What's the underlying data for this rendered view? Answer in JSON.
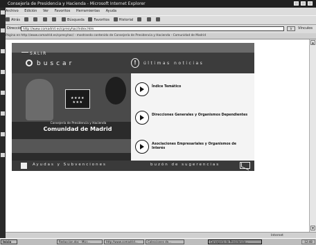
{
  "window": {
    "title": "Consejería de Presidencia y Hacienda - Microsoft Internet Explorer"
  },
  "menubar": [
    "Archivo",
    "Edición",
    "Ver",
    "Favoritos",
    "Herramientas",
    "Ayuda"
  ],
  "toolbar": {
    "back": "Atrás",
    "search": "Búsqueda",
    "favorites": "Favoritos",
    "history": "Historial"
  },
  "addressbar": {
    "label": "Dirección",
    "value": "http://www.comadrid.es/cpresyhac/index.htm",
    "go": "Ir",
    "links": "Vínculos"
  },
  "infobar": "Página en http://www.comadrid.es/cpresyhac/ - mostrando contenido de Consejería de Presidencia y Hacienda - Comunidad de Madrid",
  "site": {
    "salir": "SALIR",
    "buscar": "buscar",
    "news": "últimas noticias",
    "flag_stars": "★★★★\n★★★",
    "consejeria": "Consejería de Presidencia y Hacienda",
    "comunidad": "Comunidad de Madrid",
    "menu": [
      "Índice Temático",
      "Direcciones Generales y Organismos Dependientes",
      "Asociaciones Empresariales y Organismos de Interés"
    ],
    "ayudas": "Ayudas y Subvenciones",
    "buzon": "buzón de sugerencias"
  },
  "statusbar": {
    "left": "",
    "zone": "Internet"
  },
  "taskbar": {
    "start": "Inicio",
    "tasks": [
      "Redaccion.doc - Micr...",
      "http://www.comadrid...",
      "Colecciones de...",
      "Consejería de Presidencia..."
    ],
    "clock": "12:48"
  }
}
